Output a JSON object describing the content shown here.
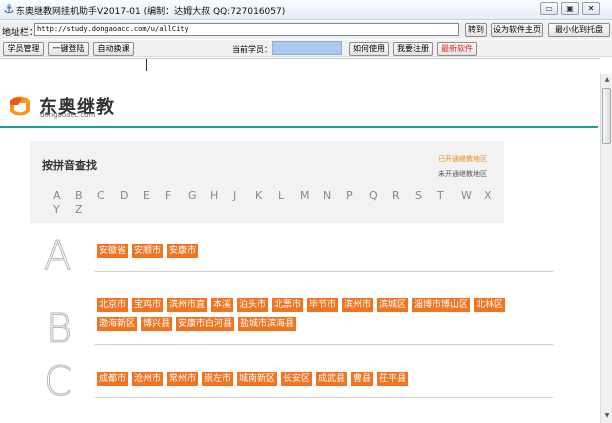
{
  "window": {
    "title": "东奥继教网挂机助手V2017-01 (编制：达姆大叔 QQ:727016057)",
    "app_icon": "anchor-icon",
    "min_label": "▭",
    "max_label": "▣",
    "close_label": "✕"
  },
  "address": {
    "label": "地址栏：",
    "url": "http://study.dongaoacc.com/u/allCity",
    "go_label": "转到",
    "set_home_label": "设为软件主页",
    "tray_label": "最小化到托盘"
  },
  "toolbar": {
    "manage_label": "学员管理",
    "login_label": "一键登陆",
    "auto_label": "自动换课",
    "current_label": "当前学员：",
    "current_value": "",
    "howto_label": "如何使用",
    "register_label": "我要注册",
    "newsoft_label": "最新软件"
  },
  "site": {
    "logo_name": "东奥继教",
    "logo_url": "dongaoacc.com",
    "search_title": "按拼音查找",
    "status_open": "已开通继教地区",
    "status_closed": "未开通继教地区",
    "alphabet": [
      "A",
      "B",
      "C",
      "D",
      "E",
      "F",
      "G",
      "H",
      "J",
      "K",
      "L",
      "M",
      "N",
      "P",
      "Q",
      "R",
      "S",
      "T",
      "W",
      "X",
      "Y",
      "Z"
    ]
  },
  "sections": [
    {
      "letter": "A",
      "cities": [
        "安徽省",
        "安顺市",
        "安康市"
      ]
    },
    {
      "letter": "B",
      "cities": [
        "北京市",
        "宝鸡市",
        "滨州市直",
        "本溪",
        "泊头市",
        "北票市",
        "毕节市",
        "滨州市",
        "滨城区",
        "淄博市博山区",
        "北林区",
        "渤海新区",
        "博兴县",
        "安康市白河县",
        "盐城市滨海县"
      ]
    },
    {
      "letter": "C",
      "cities": [
        "成都市",
        "沧州市",
        "常州市",
        "崇左市",
        "城南新区",
        "长安区",
        "成武县",
        "曹县",
        "茌平县"
      ]
    }
  ]
}
